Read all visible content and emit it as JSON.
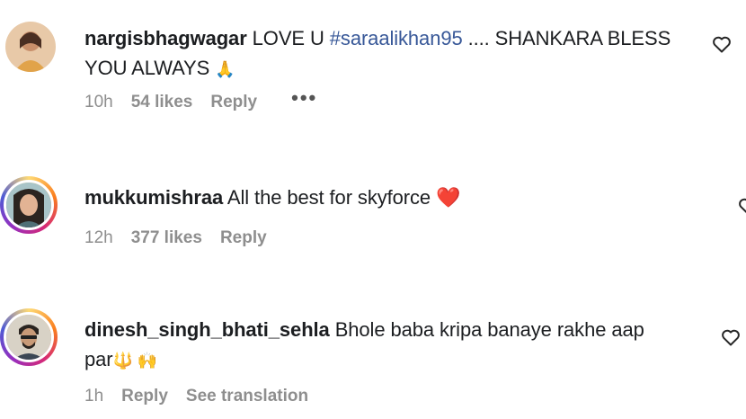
{
  "comments": [
    {
      "username": "nargisbhagwagar",
      "text_before_tag": " LOVE U ",
      "hashtag": "#saraalikhan95",
      "text_after_tag": " .... SHANKARA BLESS",
      "text_line2": "YOU ALWAYS",
      "emoji": "🙏",
      "time": "10h",
      "likes": "54 likes",
      "reply": "Reply",
      "more": "•••"
    },
    {
      "username": "mukkumishraa",
      "text": " All the best for skyforce",
      "emoji": "❤️",
      "time": "12h",
      "likes": "377 likes",
      "reply": "Reply"
    },
    {
      "username": "dinesh_singh_bhati_sehla",
      "text": " Bhole baba kripa banaye rakhe aap",
      "text_line2": "par",
      "emoji": "🔱 🙌",
      "time": "1h",
      "reply": "Reply",
      "see_translation": "See translation"
    }
  ],
  "colors": {
    "hashtag": "#385898",
    "meta": "#8e8e8e",
    "heart_red": "#e0245e"
  },
  "icons": [
    "heart-icon",
    "more-options-icon"
  ]
}
